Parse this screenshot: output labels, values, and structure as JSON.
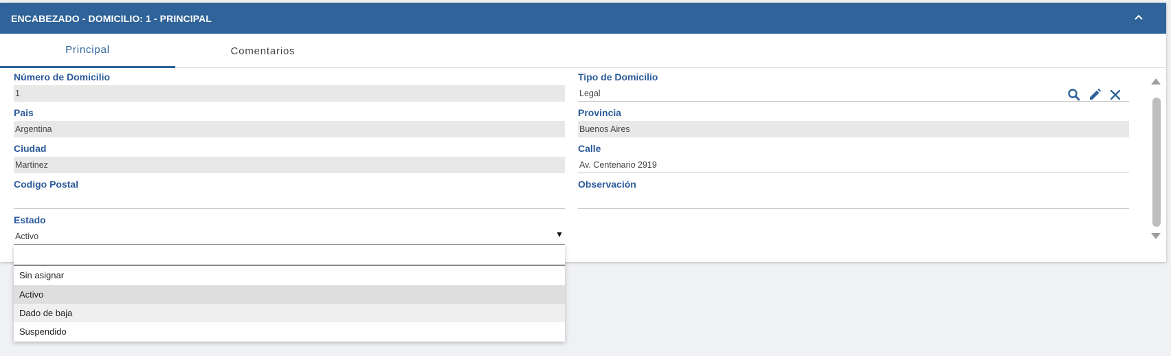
{
  "header": {
    "title": "ENCABEZADO - DOMICILIO: 1 - PRINCIPAL",
    "collapse_icon": "chevron-up-icon"
  },
  "tabs": [
    {
      "label": "Principal",
      "active": true
    },
    {
      "label": "Comentarios",
      "active": false
    }
  ],
  "fields": {
    "numero_domicilio": {
      "label": "Número de Domicilio",
      "value": "1"
    },
    "tipo_domicilio": {
      "label": "Tipo de Domicilio",
      "value": "Legal"
    },
    "pais": {
      "label": "Pais",
      "value": "Argentina"
    },
    "provincia": {
      "label": "Provincia",
      "value": "Buenos Aires"
    },
    "ciudad": {
      "label": "Ciudad",
      "value": "Martinez"
    },
    "calle": {
      "label": "Calle",
      "value": "Av. Centenario 2919"
    },
    "codigo_postal": {
      "label": "Codigo Postal",
      "value": ""
    },
    "observacion": {
      "label": "Observación",
      "value": ""
    },
    "estado": {
      "label": "Estado",
      "value": "Activo"
    }
  },
  "estado_dropdown": {
    "search_value": "",
    "options": [
      "Sin asignar",
      "Activo",
      "Dado de baja",
      "Suspendido"
    ],
    "selected": "Activo",
    "hovered": "Dado de baja"
  },
  "colors": {
    "primary": "#2f6399",
    "label": "#2a5a9a",
    "readonly_bg": "#e8e8e8",
    "page_bg": "#f0f1f4"
  }
}
